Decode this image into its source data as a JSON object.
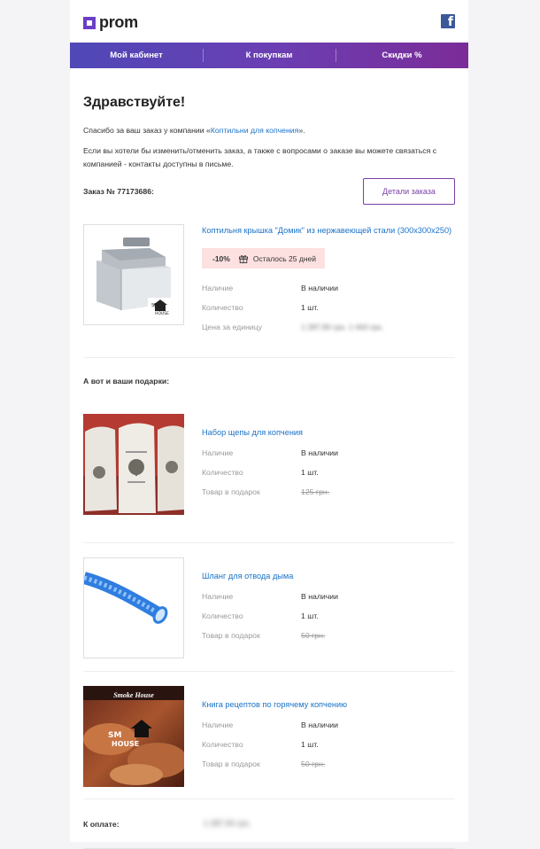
{
  "header": {
    "logo_text": "prom",
    "social_icon": "facebook-icon"
  },
  "nav": {
    "items": [
      {
        "label": "Мой кабинет"
      },
      {
        "label": "К покупкам"
      },
      {
        "label": "Скидки %"
      }
    ]
  },
  "body": {
    "greeting": "Здравствуйте!",
    "thanks_prefix": "Спасибо за ваш заказ у компании «",
    "company_name": "Коптильни для копчения",
    "thanks_suffix": "».",
    "info_text": "Если вы хотели бы изменить/отменить заказ, а также с вопросами о заказе вы можете связаться с компанией - контакты доступны в письме.",
    "order_label": "Заказ № 77173686:",
    "details_button": "Детали заказа"
  },
  "product": {
    "name": "Коптильня крышка \"Домик\" из нержавеющей стали (300x300x250)",
    "discount_percent": "-10%",
    "discount_text": "Осталось 25 дней",
    "rows": [
      {
        "label": "Наличие",
        "value": "В наличии"
      },
      {
        "label": "Количество",
        "value": "1 шт."
      },
      {
        "label": "Цена за единицу",
        "value": "1 287,90 грн. 1 443 грн."
      }
    ]
  },
  "gifts": {
    "title": "А вот и ваши подарки:",
    "items": [
      {
        "name": "Набор щепы для копчения",
        "rows": [
          {
            "label": "Наличие",
            "value": "В наличии"
          },
          {
            "label": "Количество",
            "value": "1 шт."
          },
          {
            "label": "Товар в подарок",
            "value": "125 грн."
          }
        ]
      },
      {
        "name": "Шланг для отвода дыма",
        "rows": [
          {
            "label": "Наличие",
            "value": "В наличии"
          },
          {
            "label": "Количество",
            "value": "1 шт."
          },
          {
            "label": "Товар в подарок",
            "value": "50 грн."
          }
        ]
      },
      {
        "name": "Книга рецептов по горячему копчению",
        "book_cover_title": "Smoke House",
        "rows": [
          {
            "label": "Наличие",
            "value": "В наличии"
          },
          {
            "label": "Количество",
            "value": "1 шт."
          },
          {
            "label": "Товар в подарок",
            "value": "50 грн."
          }
        ]
      }
    ]
  },
  "total": {
    "label": "К оплате:",
    "value": "1 287,90 грн."
  },
  "colors": {
    "accent": "#7b3fa8",
    "link": "#1a73c9",
    "discount_bg": "#fde0e0",
    "facebook": "#3b5998"
  }
}
